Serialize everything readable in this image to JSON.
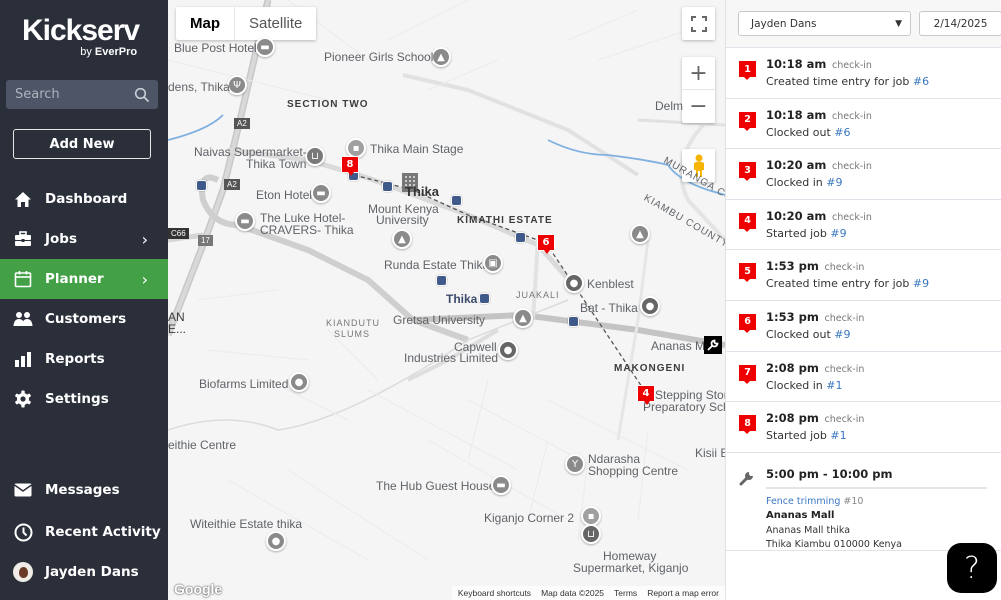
{
  "sidebar": {
    "logo": {
      "brand": "Kickserv",
      "by": "by",
      "company": "EverPro"
    },
    "search_placeholder": "Search",
    "add_new_label": "Add New",
    "nav": [
      {
        "label": "Dashboard",
        "icon": "home-icon"
      },
      {
        "label": "Jobs",
        "icon": "briefcase-icon",
        "has_submenu": true
      },
      {
        "label": "Planner",
        "icon": "calendar-icon",
        "has_submenu": true,
        "active": true
      },
      {
        "label": "Customers",
        "icon": "users-icon"
      },
      {
        "label": "Reports",
        "icon": "bar-chart-icon"
      },
      {
        "label": "Settings",
        "icon": "gear-icon"
      }
    ],
    "bottom_nav": [
      {
        "label": "Messages",
        "icon": "envelope-icon"
      },
      {
        "label": "Recent Activity",
        "icon": "clock-icon"
      },
      {
        "label": "Jayden Dans",
        "icon": "avatar"
      }
    ],
    "active_color": "#43a047",
    "bg_color": "#2a2f3a"
  },
  "map": {
    "type_toggle": {
      "map": "Map",
      "satellite": "Satellite",
      "selected": "Map"
    },
    "labels": {
      "blue_post_hotel": "Blue Post Hotel",
      "pioneer_girls_school": "Pioneer Girls School",
      "gardens_thika": "dens, Thika",
      "section_two": "SECTION TWO",
      "delmonte": "Delm",
      "naivas_1": "Naivas Supermarket-",
      "naivas_2": "Thika Town",
      "thika_main_stage": "Thika Main Stage",
      "eton_hotel": "Eton Hotel",
      "thika": "Thika",
      "mku_1": "Mount Kenya",
      "mku_2": "University",
      "kimathi_estate": "KIMATHI ESTATE",
      "luke_1": "The Luke Hotel-",
      "luke_2": "CRAVERS- Thika",
      "muranga": "MURANGA CO",
      "kiambu": "KIAMBU COUNTY",
      "runda": "Runda Estate Thika",
      "kenblest": "Kenblest",
      "juakali": "JUAKALI",
      "thika_stage": "Thika",
      "bat": "Bat - Thika",
      "kiandutu_1": "KIANDUTU",
      "kiandutu_2": "SLUMS",
      "gretsa": "Gretsa University",
      "capwell_1": "Capwell",
      "capwell_2": "Industries Limited",
      "ananas": "Ananas Mall",
      "makongeni": "MAKONGENI",
      "stepping_1": "Stepping Stor",
      "stepping_2": "Preparatory Sch",
      "an_1": "AN",
      "an_2": "E...",
      "biofarms": "Biofarms Limited",
      "witeithie_centre": "eithie Centre",
      "kisii": "Kisii E",
      "ndarasha_1": "Ndarasha",
      "ndarasha_2": "Shopping Centre",
      "hub": "The Hub Guest House",
      "kiganjo": "Kiganjo Corner 2",
      "witeithie_estate": "Witeithie Estate thika",
      "homeway_1": "Homeway",
      "homeway_2": "Supermarket, Kiganjo"
    },
    "road_shields": {
      "a2_top": "A2",
      "a2": "A2",
      "c66": "C66",
      "r17": "17"
    },
    "markers": [
      {
        "label": "8"
      },
      {
        "label": "6"
      },
      {
        "label": "4"
      }
    ],
    "job_marker_icon": "wrench-icon",
    "controls": {
      "fullscreen": "fullscreen-icon",
      "zoom_in": "+",
      "zoom_out": "−",
      "pegman": "pegman-icon"
    },
    "footer": {
      "keyboard": "Keyboard shortcuts",
      "mapdata": "Map data ©2025",
      "terms": "Terms",
      "report": "Report a map error"
    },
    "google": "Google"
  },
  "panel": {
    "user_select": "Jayden Dans",
    "date": "2/14/2025",
    "entries": [
      {
        "n": "1",
        "time": "10:18 am",
        "tag": "check-in",
        "text": "Created time entry for job ",
        "job": "#6"
      },
      {
        "n": "2",
        "time": "10:18 am",
        "tag": "check-in",
        "text": "Clocked out ",
        "job": "#6"
      },
      {
        "n": "3",
        "time": "10:20 am",
        "tag": "check-in",
        "text": "Clocked in ",
        "job": "#9"
      },
      {
        "n": "4",
        "time": "10:20 am",
        "tag": "check-in",
        "text": "Started job ",
        "job": "#9"
      },
      {
        "n": "5",
        "time": "1:53 pm",
        "tag": "check-in",
        "text": "Created time entry for job ",
        "job": "#9"
      },
      {
        "n": "6",
        "time": "1:53 pm",
        "tag": "check-in",
        "text": "Clocked out ",
        "job": "#9"
      },
      {
        "n": "7",
        "time": "2:08 pm",
        "tag": "check-in",
        "text": "Clocked in ",
        "job": "#1"
      },
      {
        "n": "8",
        "time": "2:08 pm",
        "tag": "check-in",
        "text": "Started job ",
        "job": "#1"
      }
    ],
    "job": {
      "range": "5:00 pm - 10:00 pm",
      "name": "Fence trimming",
      "number": "#10",
      "customer": "Ananas Mall",
      "address1": "Ananas Mall thika",
      "address2": "Thika Kiambu 010000 Kenya"
    },
    "marker_color": "#ee0000",
    "link_color": "#3a78c2"
  },
  "help_button": "?"
}
